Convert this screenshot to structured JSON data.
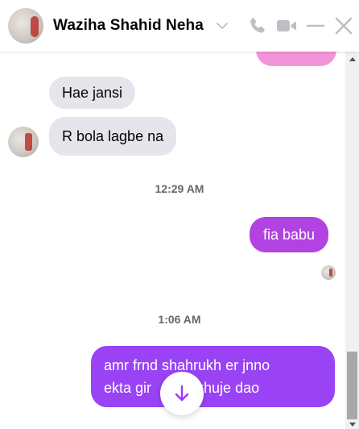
{
  "header": {
    "contact_name": "Waziha Shahid Neha",
    "icons": [
      "chevron-down-icon",
      "phone-icon",
      "video-icon",
      "minimize-icon",
      "close-icon"
    ],
    "icon_color": "#bcc0c4"
  },
  "messages": [
    {
      "type": "outgoing-partial",
      "color": "#f494d8"
    },
    {
      "type": "incoming",
      "text": "Hae jansi"
    },
    {
      "type": "incoming",
      "text": "R bola lagbe na"
    },
    {
      "type": "timestamp",
      "text": "12:29 AM"
    },
    {
      "type": "outgoing",
      "text": "fia babu",
      "color": "#b242e2"
    },
    {
      "type": "timestamp",
      "text": "1:06 AM"
    },
    {
      "type": "outgoing",
      "line1": "amr frnd shahrukh er jnno",
      "line2": "ekta girl khuje dao",
      "color": "#9a43f5"
    }
  ],
  "conversation": {
    "msg1": "Hae jansi",
    "msg2": "R bola lagbe na",
    "ts1": "12:29 AM",
    "msg3": "fia babu",
    "ts2": "1:06 AM",
    "msg4_line1": "amr frnd shahrukh er jnno",
    "msg4_line2_a": "ekta gir",
    "msg4_line2_b": "khuje dao"
  },
  "colors": {
    "accent_purple": "#9a43f5",
    "pink_bubble": "#f494d8",
    "incoming_bubble": "#e4e6eb"
  },
  "jump_button": {
    "icon": "arrow-down-icon",
    "color": "#a033ff"
  }
}
